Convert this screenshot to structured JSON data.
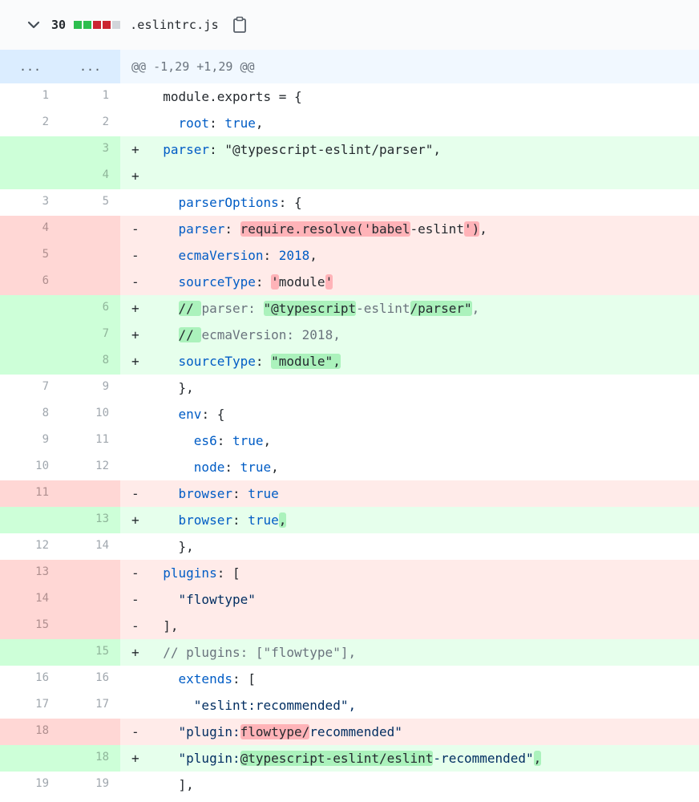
{
  "file": {
    "change_count": "30",
    "blocks": [
      "#2cbe4e",
      "#2cbe4e",
      "#cb2431",
      "#cb2431",
      "#d1d5da"
    ],
    "name": ".eslintrc.js"
  },
  "hunk": {
    "old_num": "...",
    "new_num": "...",
    "header": "@@ -1,29 +1,29 @@"
  },
  "rows": [
    {
      "type": "ctx",
      "old": "1",
      "new": "1",
      "marker": " ",
      "segments": [
        {
          "t": "module.exports = {",
          "c": ""
        }
      ],
      "indent": "  "
    },
    {
      "type": "ctx",
      "old": "2",
      "new": "2",
      "marker": " ",
      "indent": "    ",
      "segments": [
        {
          "t": "root",
          "c": "pr"
        },
        {
          "t": ": ",
          "c": ""
        },
        {
          "t": "true",
          "c": "kw"
        },
        {
          "t": ",",
          "c": ""
        }
      ]
    },
    {
      "type": "add",
      "old": "",
      "new": "3",
      "marker": "+",
      "indent": "  ",
      "segments": [
        {
          "t": "parser",
          "c": "pr"
        },
        {
          "t": ": \"@typescript-eslint/parser\",",
          "c": ""
        }
      ]
    },
    {
      "type": "add",
      "old": "",
      "new": "4",
      "marker": "+",
      "indent": "",
      "segments": []
    },
    {
      "type": "ctx",
      "old": "3",
      "new": "5",
      "marker": " ",
      "indent": "    ",
      "segments": [
        {
          "t": "parserOptions",
          "c": "pr"
        },
        {
          "t": ": {",
          "c": ""
        }
      ]
    },
    {
      "type": "del",
      "old": "4",
      "new": "",
      "marker": "-",
      "indent": "    ",
      "segments": [
        {
          "t": "parser",
          "c": "pr"
        },
        {
          "t": ": ",
          "c": ""
        },
        {
          "t": "require.resolve('babel",
          "c": "hl-del"
        },
        {
          "t": "-eslint",
          "c": ""
        },
        {
          "t": "')",
          "c": "hl-del"
        },
        {
          "t": ",",
          "c": ""
        }
      ]
    },
    {
      "type": "del",
      "old": "5",
      "new": "",
      "marker": "-",
      "indent": "    ",
      "segments": [
        {
          "t": "ecmaVersion",
          "c": "pr"
        },
        {
          "t": ": ",
          "c": ""
        },
        {
          "t": "2018",
          "c": "kw"
        },
        {
          "t": ",",
          "c": ""
        }
      ]
    },
    {
      "type": "del",
      "old": "6",
      "new": "",
      "marker": "-",
      "indent": "    ",
      "segments": [
        {
          "t": "sourceType",
          "c": "pr"
        },
        {
          "t": ": ",
          "c": ""
        },
        {
          "t": "'",
          "c": "hl-del"
        },
        {
          "t": "module",
          "c": ""
        },
        {
          "t": "'",
          "c": "hl-del"
        }
      ]
    },
    {
      "type": "add",
      "old": "",
      "new": "6",
      "marker": "+",
      "indent": "    ",
      "segments": [
        {
          "t": "// ",
          "c": "hl-add"
        },
        {
          "t": "parser: ",
          "c": "cm"
        },
        {
          "t": "\"@typescript",
          "c": "hl-add"
        },
        {
          "t": "-eslint",
          "c": "cm"
        },
        {
          "t": "/parser\"",
          "c": "hl-add"
        },
        {
          "t": ",",
          "c": "cm"
        }
      ]
    },
    {
      "type": "add",
      "old": "",
      "new": "7",
      "marker": "+",
      "indent": "    ",
      "segments": [
        {
          "t": "// ",
          "c": "hl-add"
        },
        {
          "t": "ecmaVersion: 2018,",
          "c": "cm"
        }
      ]
    },
    {
      "type": "add",
      "old": "",
      "new": "8",
      "marker": "+",
      "indent": "    ",
      "segments": [
        {
          "t": "sourceType",
          "c": "pr"
        },
        {
          "t": ": ",
          "c": ""
        },
        {
          "t": "\"module\",",
          "c": "hl-add"
        }
      ]
    },
    {
      "type": "ctx",
      "old": "7",
      "new": "9",
      "marker": " ",
      "indent": "    ",
      "segments": [
        {
          "t": "},",
          "c": ""
        }
      ]
    },
    {
      "type": "ctx",
      "old": "8",
      "new": "10",
      "marker": " ",
      "indent": "    ",
      "segments": [
        {
          "t": "env",
          "c": "pr"
        },
        {
          "t": ": {",
          "c": ""
        }
      ]
    },
    {
      "type": "ctx",
      "old": "9",
      "new": "11",
      "marker": " ",
      "indent": "      ",
      "segments": [
        {
          "t": "es6",
          "c": "pr"
        },
        {
          "t": ": ",
          "c": ""
        },
        {
          "t": "true",
          "c": "kw"
        },
        {
          "t": ",",
          "c": ""
        }
      ]
    },
    {
      "type": "ctx",
      "old": "10",
      "new": "12",
      "marker": " ",
      "indent": "      ",
      "segments": [
        {
          "t": "node",
          "c": "pr"
        },
        {
          "t": ": ",
          "c": ""
        },
        {
          "t": "true",
          "c": "kw"
        },
        {
          "t": ",",
          "c": ""
        }
      ]
    },
    {
      "type": "del",
      "old": "11",
      "new": "",
      "marker": "-",
      "indent": "    ",
      "segments": [
        {
          "t": "browser",
          "c": "pr"
        },
        {
          "t": ": ",
          "c": ""
        },
        {
          "t": "true",
          "c": "kw"
        }
      ]
    },
    {
      "type": "add",
      "old": "",
      "new": "13",
      "marker": "+",
      "indent": "    ",
      "segments": [
        {
          "t": "browser",
          "c": "pr"
        },
        {
          "t": ": ",
          "c": ""
        },
        {
          "t": "true",
          "c": "kw"
        },
        {
          "t": ",",
          "c": "hl-add"
        }
      ]
    },
    {
      "type": "ctx",
      "old": "12",
      "new": "14",
      "marker": " ",
      "indent": "    ",
      "segments": [
        {
          "t": "},",
          "c": ""
        }
      ]
    },
    {
      "type": "del",
      "old": "13",
      "new": "",
      "marker": "-",
      "indent": "  ",
      "segments": [
        {
          "t": "plugins",
          "c": "pr"
        },
        {
          "t": ": [",
          "c": ""
        }
      ]
    },
    {
      "type": "del",
      "old": "14",
      "new": "",
      "marker": "-",
      "indent": "    ",
      "segments": [
        {
          "t": "\"flowtype\"",
          "c": "st"
        }
      ]
    },
    {
      "type": "del",
      "old": "15",
      "new": "",
      "marker": "-",
      "indent": "  ",
      "segments": [
        {
          "t": "],",
          "c": ""
        }
      ]
    },
    {
      "type": "add",
      "old": "",
      "new": "15",
      "marker": "+",
      "indent": "  ",
      "segments": [
        {
          "t": "// plugins: [\"flowtype\"],",
          "c": "cm"
        }
      ]
    },
    {
      "type": "ctx",
      "old": "16",
      "new": "16",
      "marker": " ",
      "indent": "    ",
      "segments": [
        {
          "t": "extends",
          "c": "pr"
        },
        {
          "t": ": [",
          "c": ""
        }
      ]
    },
    {
      "type": "ctx",
      "old": "17",
      "new": "17",
      "marker": " ",
      "indent": "      ",
      "segments": [
        {
          "t": "\"eslint:recommended\",",
          "c": "st"
        }
      ]
    },
    {
      "type": "del",
      "old": "18",
      "new": "",
      "marker": "-",
      "indent": "    ",
      "segments": [
        {
          "t": "\"plugin:",
          "c": "st"
        },
        {
          "t": "flowtype/",
          "c": "hl-del"
        },
        {
          "t": "recommended\"",
          "c": "st"
        }
      ]
    },
    {
      "type": "add",
      "old": "",
      "new": "18",
      "marker": "+",
      "indent": "    ",
      "segments": [
        {
          "t": "\"plugin:",
          "c": "st"
        },
        {
          "t": "@typescript-eslint/eslint",
          "c": "hl-add"
        },
        {
          "t": "-recommended\"",
          "c": "st"
        },
        {
          "t": ",",
          "c": "hl-add"
        }
      ]
    },
    {
      "type": "ctx",
      "old": "19",
      "new": "19",
      "marker": " ",
      "indent": "    ",
      "segments": [
        {
          "t": "],",
          "c": ""
        }
      ]
    }
  ]
}
